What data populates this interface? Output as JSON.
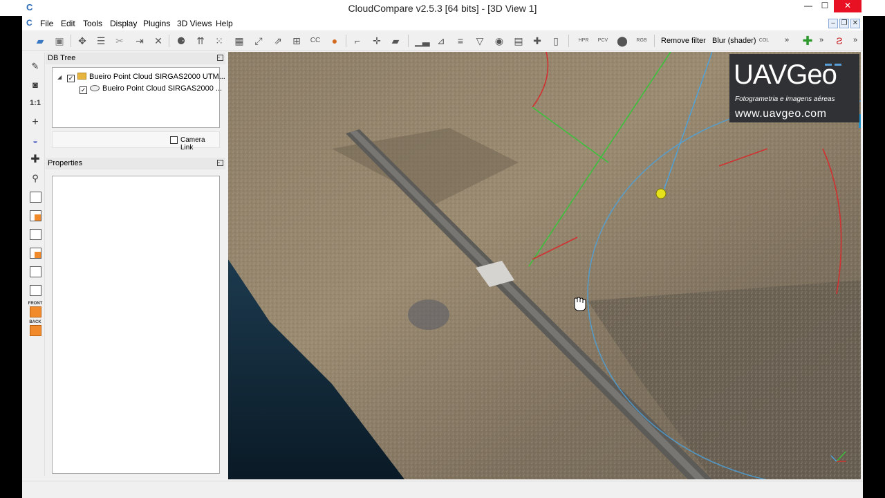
{
  "window": {
    "title": "CloudCompare v2.5.3 [64 bits] - [3D View 1]",
    "minimize": "—",
    "maximize": "☐",
    "close": "✕"
  },
  "menu": {
    "items": [
      "File",
      "Edit",
      "Tools",
      "Display",
      "Plugins",
      "3D Views",
      "Help"
    ],
    "mdi_min": "–",
    "mdi_restore": "❐",
    "mdi_close": "✕"
  },
  "toolbar": {
    "remove_filter": "Remove filter",
    "blur_shader": "Blur (shader)",
    "more": "»",
    "icons": [
      "open-icon",
      "save-icon",
      "translate-rotate-icon",
      "list-icon",
      "segment-icon",
      "merge-icon",
      "delete-icon",
      "normals-icon",
      "octree-icon",
      "sample-icon",
      "mesh-icon",
      "register-icon",
      "distance-icon",
      "cc-icon",
      "color-icon",
      "pick-icon",
      "translate-icon",
      "plane-icon",
      "histogram-icon",
      "stat-icon",
      "filter-icon",
      "gradient-icon",
      "sphere-icon",
      "table-icon",
      "plus-icon",
      "trash-icon",
      "hpr-icon",
      "pcv-icon",
      "ssao-icon",
      "rgb-icon"
    ],
    "shader_labels": [
      "HPR",
      "PCV",
      "RGB",
      "COL"
    ]
  },
  "left_toolbar": {
    "ratio_label": "1:1",
    "front_label": "FRONT",
    "back_label": "BACK"
  },
  "db_tree": {
    "title": "DB Tree",
    "float": "▫",
    "root_label": "Bueiro Point Cloud SIRGAS2000 UTM...",
    "child_label": "Bueiro Point Cloud SIRGAS2000 ...",
    "camera_link": "Camera Link",
    "check": "✓"
  },
  "properties": {
    "title": "Properties",
    "float": "▫"
  },
  "logo": {
    "brand": "UAVGeo",
    "tagline": "Fotogrametria e imagens aéreas",
    "url": "www.uavgeo.com"
  }
}
